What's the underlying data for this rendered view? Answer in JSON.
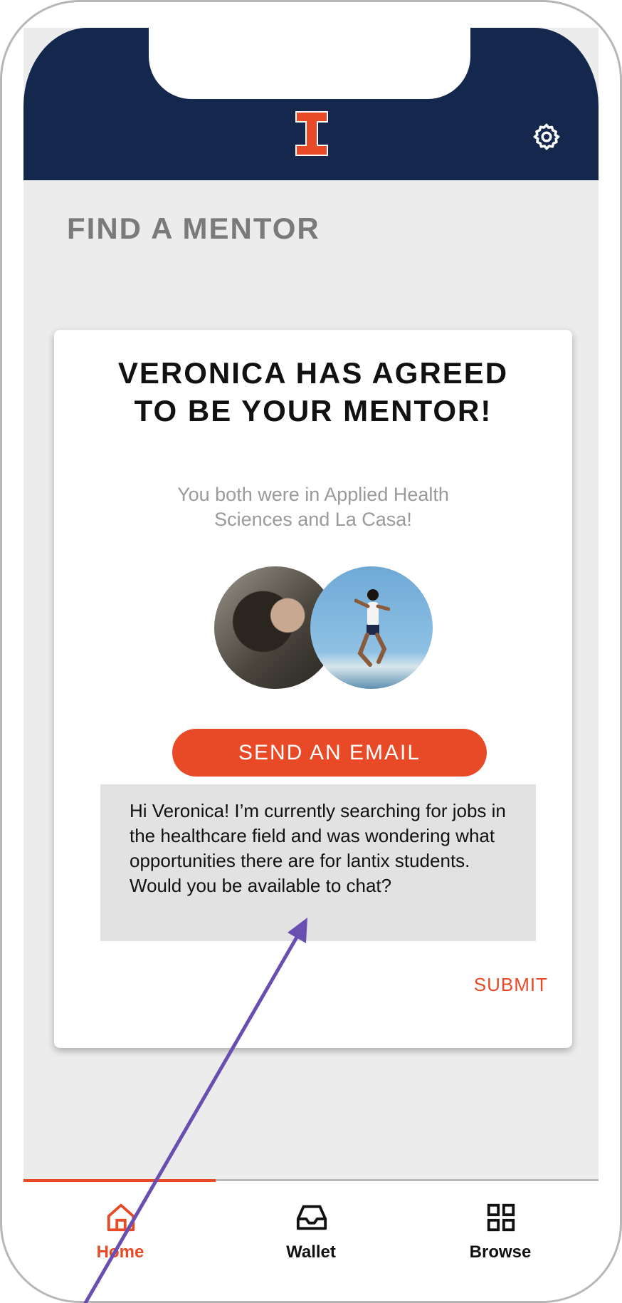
{
  "header": {
    "logo": "illinois-block-i-logo",
    "settings_icon": "gear-icon"
  },
  "page": {
    "title": "FIND A MENTOR"
  },
  "card": {
    "title": "VERONICA HAS AGREED TO BE YOUR MENTOR!",
    "subtitle": "You both were in Applied Health Sciences and La Casa!",
    "send_button_label": "SEND AN EMAIL",
    "message": "Hi Veronica! I’m currently searching for jobs in the healthcare field and was wondering what opportunities there are for lantix students. Would you be available to chat?",
    "submit_label": "SUBMIT"
  },
  "tabs": [
    {
      "label": "Home",
      "icon": "home-icon",
      "active": true
    },
    {
      "label": "Wallet",
      "icon": "inbox-tray-icon",
      "active": false
    },
    {
      "label": "Browse",
      "icon": "grid-icon",
      "active": false
    }
  ],
  "colors": {
    "header_bg": "#14284d",
    "accent": "#e84a27",
    "background": "#ececec",
    "annotation": "#6a4fb3"
  }
}
